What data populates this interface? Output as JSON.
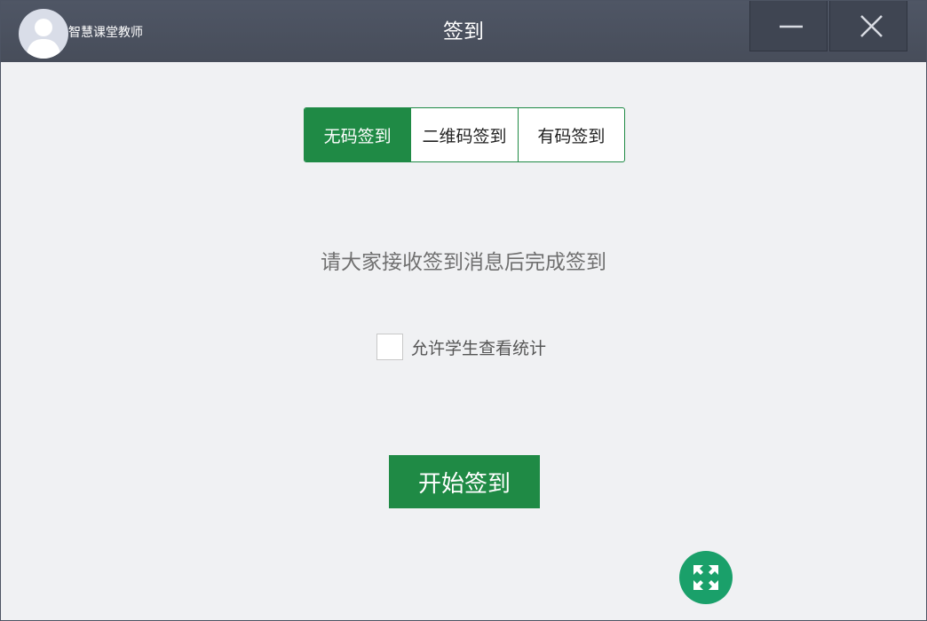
{
  "titlebar": {
    "title": "签到",
    "user_name": "智慧课堂教师",
    "avatar_icon": "user-avatar-icon",
    "minimize_icon": "minimize-icon",
    "close_icon": "close-icon"
  },
  "tabs": {
    "items": [
      {
        "label": "无码签到",
        "active": true
      },
      {
        "label": "二维码签到",
        "active": false
      },
      {
        "label": "有码签到",
        "active": false
      }
    ]
  },
  "main": {
    "hint": "请大家接收签到消息后完成签到",
    "allow_view_label": "允许学生查看统计",
    "allow_view_checked": false,
    "start_button_label": "开始签到",
    "fullscreen_icon": "expand-icon"
  },
  "colors": {
    "accent_green": "#1f8a45",
    "fullscreen_button": "#1aa06a",
    "titlebar": "#4b5261"
  }
}
